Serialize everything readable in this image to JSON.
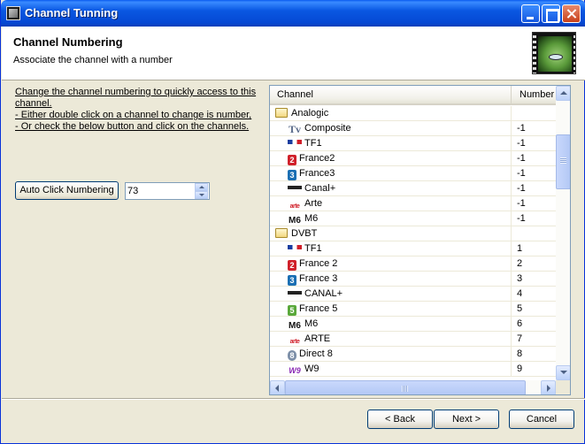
{
  "window": {
    "title": "Channel Tunning"
  },
  "header": {
    "title": "Channel Numbering",
    "subtitle": "Associate the channel with a number"
  },
  "instructions": {
    "line1": "Change the channel numbering to quickly access to this",
    "line2": "channel.",
    "line3": "- Either double click on a channel to change is number,",
    "line4": "- Or check the below button and click on the channels."
  },
  "controls": {
    "auto_click_label": "Auto Click Numbering",
    "spin_value": "73"
  },
  "list": {
    "columns": {
      "channel": "Channel",
      "number": "Number"
    },
    "rows": [
      {
        "type": "group",
        "name": "Analogic",
        "number": "",
        "icon": "folder-icon"
      },
      {
        "type": "item",
        "name": "Composite",
        "number": "-1",
        "icon": "tv-icon"
      },
      {
        "type": "item",
        "name": "TF1",
        "number": "-1",
        "icon": "tf1-logo-icon"
      },
      {
        "type": "item",
        "name": "France2",
        "number": "-1",
        "icon": "france2-logo-icon"
      },
      {
        "type": "item",
        "name": "France3",
        "number": "-1",
        "icon": "france3-logo-icon"
      },
      {
        "type": "item",
        "name": "Canal+",
        "number": "-1",
        "icon": "canal-plus-logo-icon"
      },
      {
        "type": "item",
        "name": "Arte",
        "number": "-1",
        "icon": "arte-logo-icon"
      },
      {
        "type": "item",
        "name": "M6",
        "number": "-1",
        "icon": "m6-logo-icon"
      },
      {
        "type": "group",
        "name": "DVBT",
        "number": "",
        "icon": "folder-icon"
      },
      {
        "type": "item",
        "name": "TF1",
        "number": "1",
        "icon": "tf1-logo-icon"
      },
      {
        "type": "item",
        "name": "France 2",
        "number": "2",
        "icon": "france2-logo-icon"
      },
      {
        "type": "item",
        "name": "France 3",
        "number": "3",
        "icon": "france3-logo-icon"
      },
      {
        "type": "item",
        "name": "CANAL+",
        "number": "4",
        "icon": "canal-plus-logo-icon"
      },
      {
        "type": "item",
        "name": "France 5",
        "number": "5",
        "icon": "france5-logo-icon"
      },
      {
        "type": "item",
        "name": "M6",
        "number": "6",
        "icon": "m6-logo-icon"
      },
      {
        "type": "item",
        "name": "ARTE",
        "number": "7",
        "icon": "arte-logo-icon"
      },
      {
        "type": "item",
        "name": "Direct 8",
        "number": "8",
        "icon": "direct8-logo-icon"
      },
      {
        "type": "item",
        "name": "W9",
        "number": "9",
        "icon": "w9-logo-icon"
      }
    ]
  },
  "footer": {
    "back_label": "< Back",
    "next_label": "Next >",
    "cancel_label": "Cancel"
  }
}
